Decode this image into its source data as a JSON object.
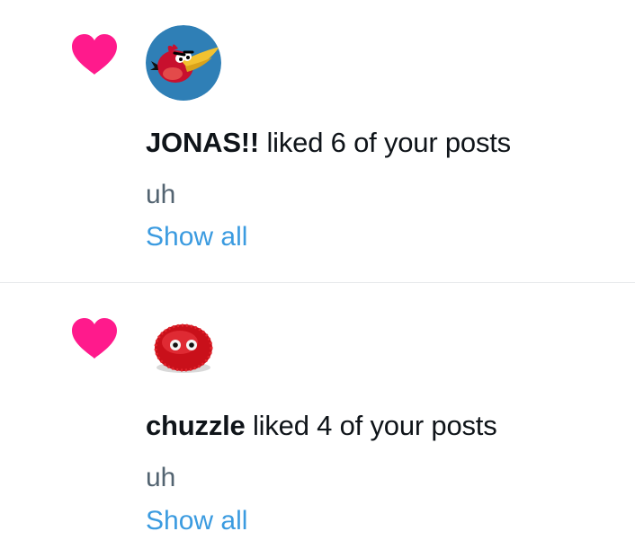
{
  "colors": {
    "heart": "#ff1a8c",
    "link": "#3b9be0",
    "snippet": "#536471",
    "divider": "#e6e9eb"
  },
  "notifications": [
    {
      "icon": "heart-icon",
      "avatar": "angry-bird-avatar",
      "user": "JONAS!!",
      "action": " liked 6 of your posts",
      "snippet": "uh",
      "link": "Show all"
    },
    {
      "icon": "heart-icon",
      "avatar": "red-fuzzball-avatar",
      "user": "chuzzle",
      "action": " liked 4 of your posts",
      "snippet": "uh",
      "link": "Show all"
    }
  ]
}
